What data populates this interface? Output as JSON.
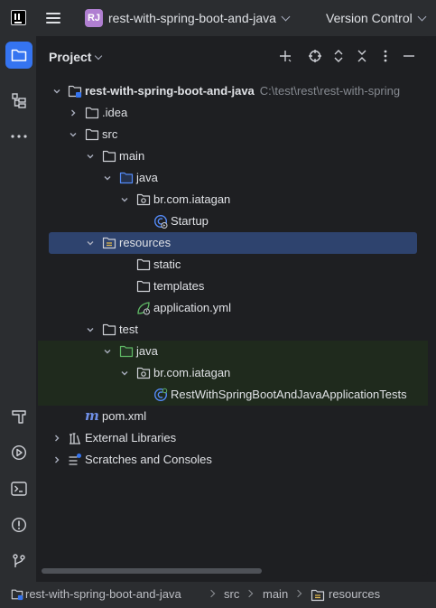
{
  "titlebar": {
    "project_badge": "RJ",
    "project_name": "rest-with-spring-boot-and-java",
    "vcs_label": "Version Control"
  },
  "panel": {
    "title": "Project"
  },
  "tree": {
    "root": {
      "name": "rest-with-spring-boot-and-java",
      "path": "C:\\test\\rest\\rest-with-spring"
    },
    "idea": ".idea",
    "src": "src",
    "main": "main",
    "java_main": "java",
    "pkg_main": "br.com.iatagan",
    "startup": "Startup",
    "resources": "resources",
    "static": "static",
    "templates": "templates",
    "app_yml": "application.yml",
    "test": "test",
    "java_test": "java",
    "pkg_test": "br.com.iatagan",
    "test_class": "RestWithSpringBootAndJavaApplicationTests",
    "pom": "pom.xml",
    "ext_libs": "External Libraries",
    "scratches": "Scratches and Consoles"
  },
  "breadcrumb": [
    "rest-with-spring-boot-and-java",
    "src",
    "main",
    "resources"
  ],
  "colors": {
    "accent": "#3574f0",
    "selection": "#2e436e",
    "test_bg": "#1f2a1d",
    "badge": "#b07fd1",
    "folder_source": "#548af7",
    "folder_test": "#5fb865"
  }
}
